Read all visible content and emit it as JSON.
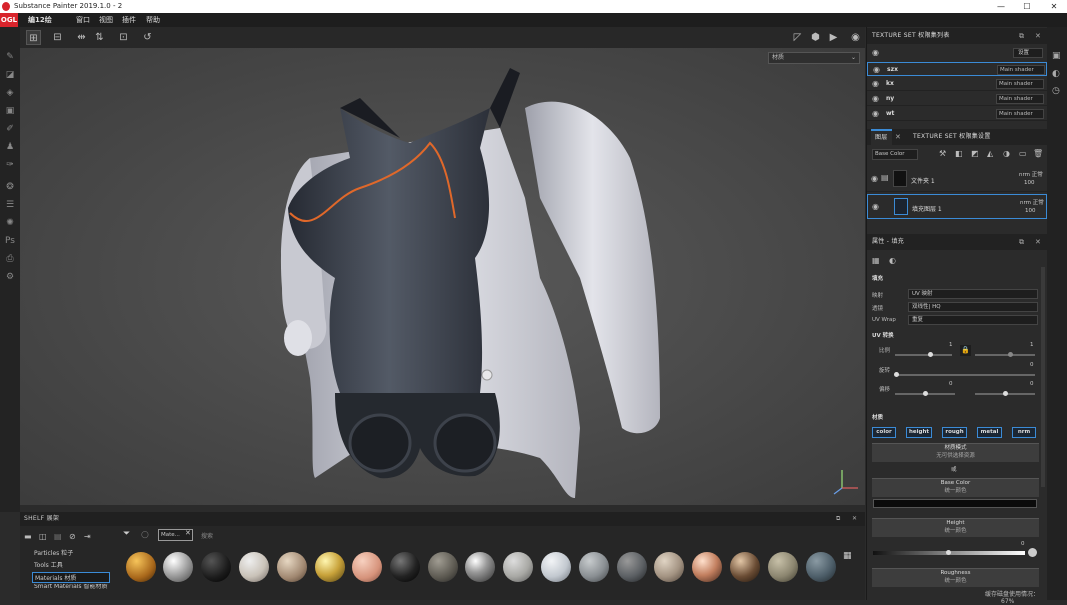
{
  "titlebar": {
    "title": "Substance Painter 2019.1.0 - 2",
    "minimize": "—",
    "maximize": "☐",
    "close": "✕"
  },
  "menubar": {
    "brand": "OGL",
    "logo_text": "编12绘",
    "items": [
      "窗口",
      "视图",
      "插件",
      "帮助"
    ]
  },
  "viewport": {
    "select_label": "材质"
  },
  "texture_set_list": {
    "title": "TEXTURE SET 权限集列表",
    "settings_label": "设置",
    "rows": [
      {
        "name": "szx",
        "shader": "Main shader"
      },
      {
        "name": "kx",
        "shader": "Main shader"
      },
      {
        "name": "ny",
        "shader": "Main shader"
      },
      {
        "name": "wt",
        "shader": "Main shader"
      }
    ]
  },
  "layers_tabs": {
    "layers": "图层",
    "settings": "TEXTURE SET 权限集设置"
  },
  "layers": {
    "channel": "Base Color",
    "items": [
      {
        "name": "文件夹 1",
        "blend": "nrm 正常",
        "opacity": "100"
      },
      {
        "name": "填充图层 1",
        "blend": "nrm 正常",
        "opacity": "100"
      }
    ]
  },
  "properties": {
    "title": "属性 - 填充",
    "fill_section": "填充",
    "projection_label": "映射",
    "projection_value": "UV 映射",
    "filtering_label": "透镜",
    "filtering_value": "双线性| HQ",
    "uvwrap_label": "UV Wrap",
    "uvwrap_value": "重复",
    "uv_transform": "UV 转换",
    "scale_label": "比例",
    "scale_value": "1",
    "scale_value2": "1",
    "rotation_label": "旋转",
    "rotation_value": "0",
    "offset_label": "偏移",
    "offset_value": "0",
    "offset_value2": "0",
    "material_section": "材质",
    "channels": [
      "color",
      "height",
      "rough",
      "metal",
      "nrm"
    ],
    "material_mode_title": "材质模式",
    "material_mode_sub": "无可供选择资源",
    "or_label": "或",
    "base_color_title": "Base Color",
    "base_color_sub": "统一颜色",
    "height_title": "Height",
    "height_sub": "统一颜色",
    "height_value": "0",
    "roughness_title": "Roughness",
    "roughness_sub": "统一颜色"
  },
  "shelf": {
    "title": "SHELF 展架",
    "filter_tag": "Mate...",
    "search_placeholder": "搜索",
    "nav": [
      {
        "label": "Particles 粒子"
      },
      {
        "label": "Tools 工具"
      },
      {
        "label": "Materials 材质"
      },
      {
        "label": "Smart Materials 智能材质"
      }
    ]
  },
  "statusbar": {
    "text": "缓存磁盘使用情况：",
    "percent": "67%"
  },
  "colors": {
    "accent": "#3b8bd6",
    "brand": "#d8242c",
    "panel": "#2b2b2b",
    "viewport_bg": "#4e4e4e"
  }
}
